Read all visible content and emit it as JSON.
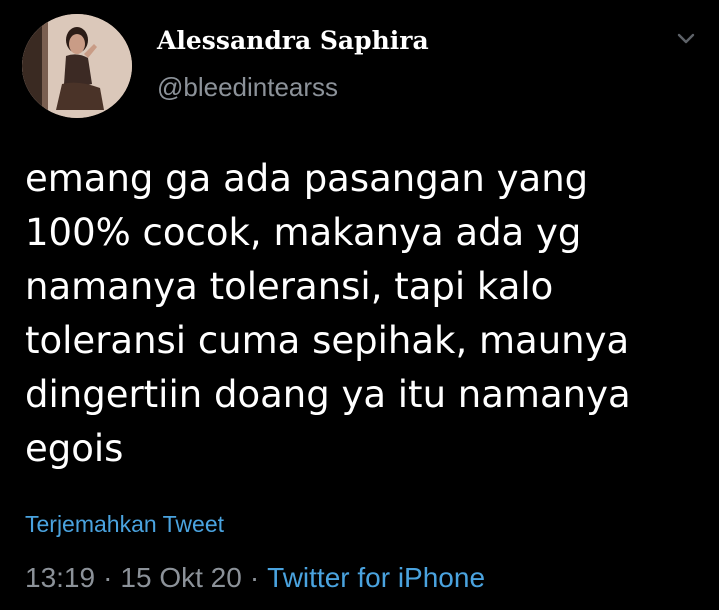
{
  "author": {
    "display_name": "Alessandra Saphira",
    "handle": "@bleedintearss"
  },
  "tweet": {
    "text_lines": [
      "emang ga ada pasangan yang",
      "100% cocok, makanya ada yg",
      "namanya toleransi, tapi kalo",
      "toleransi cuma sepihak, maunya",
      "dingertiin doang ya itu namanya",
      "egois"
    ],
    "translate_label": "Terjemahkan Tweet",
    "time": "13:19",
    "separator": "·",
    "date": "15 Okt 20",
    "source": "Twitter for iPhone"
  },
  "icons": {
    "menu": "chevron-down-icon",
    "avatar": "avatar"
  },
  "colors": {
    "background": "#000000",
    "text": "#ffffff",
    "muted": "#8c9299",
    "link": "#4aa3df"
  }
}
